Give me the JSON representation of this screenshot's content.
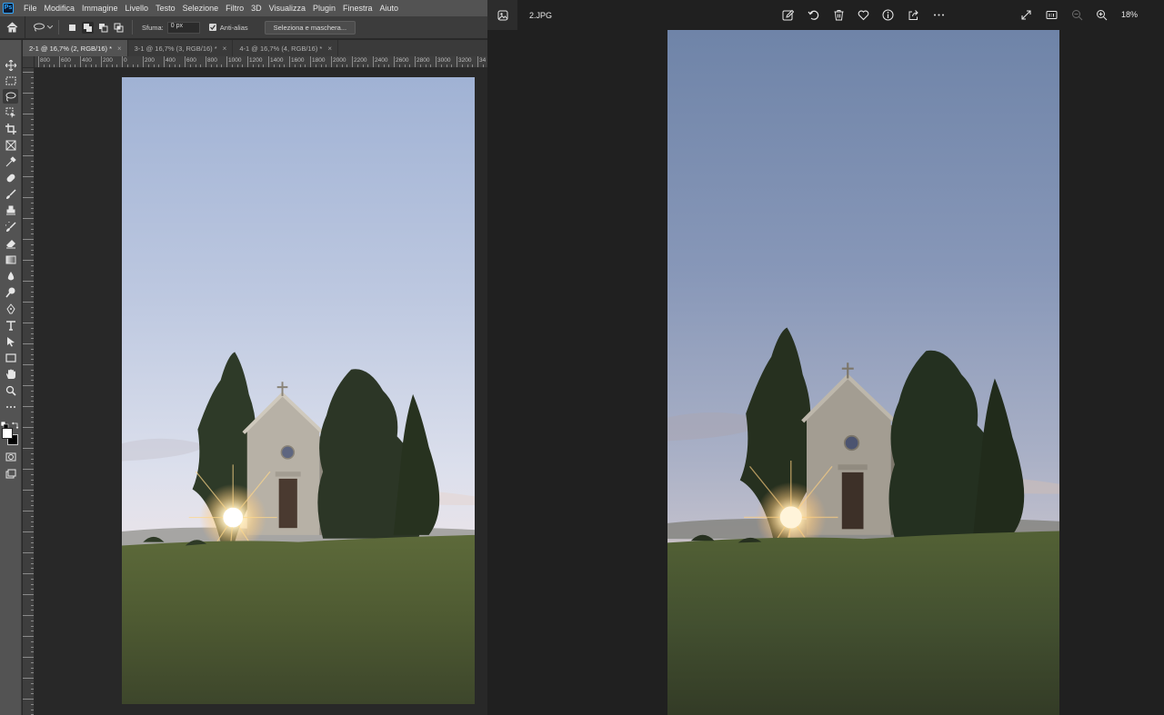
{
  "photoshop": {
    "logo": "Ps",
    "menu": [
      "File",
      "Modifica",
      "Immagine",
      "Livello",
      "Testo",
      "Selezione",
      "Filtro",
      "3D",
      "Visualizza",
      "Plugin",
      "Finestra",
      "Aiuto"
    ],
    "options": {
      "feather_label": "Sfuma:",
      "feather_value": "0 px",
      "antialias_label": "Anti-alias",
      "select_mask_label": "Seleziona e maschera..."
    },
    "tabs": [
      {
        "label": "2-1 @ 16,7% (2, RGB/16) *",
        "close": "×"
      },
      {
        "label": "3-1 @ 16,7% (3, RGB/16) *",
        "close": "×"
      },
      {
        "label": "4-1 @ 16,7% (4, RGB/16) *",
        "close": "×"
      }
    ],
    "ruler_h_labels": [
      "800",
      "600",
      "400",
      "200",
      "0",
      "200",
      "400",
      "600",
      "800",
      "1000",
      "1200",
      "1400",
      "1600",
      "1800",
      "2000",
      "2200",
      "2400",
      "2600",
      "2800",
      "3000",
      "3200",
      "34"
    ],
    "tools": [
      "move-tool",
      "marquee-tool",
      "lasso-tool",
      "object-selection-tool",
      "crop-tool",
      "frame-tool",
      "eyedropper-tool",
      "healing-brush-tool",
      "brush-tool",
      "clone-stamp-tool",
      "history-brush-tool",
      "eraser-tool",
      "gradient-tool",
      "blur-tool",
      "dodge-tool",
      "pen-tool",
      "type-tool",
      "path-selection-tool",
      "rectangle-tool",
      "hand-tool",
      "zoom-tool",
      "more-tools"
    ],
    "foreground_color": "#ffffff",
    "background_color": "#000000"
  },
  "viewer": {
    "file_name": "2.JPG",
    "zoom": "18%",
    "toolbar_icons": [
      "edit-image-icon",
      "rotate-icon",
      "delete-icon",
      "favorite-icon",
      "info-icon",
      "share-icon",
      "more-icon",
      "fullscreen-icon",
      "actual-size-icon",
      "zoom-out-icon",
      "zoom-in-icon"
    ]
  },
  "colors": {
    "ps_chrome": "#535353",
    "ps_workspace": "#282828",
    "viewer_bg": "#202020",
    "accent_ps": "#31a8ff"
  }
}
